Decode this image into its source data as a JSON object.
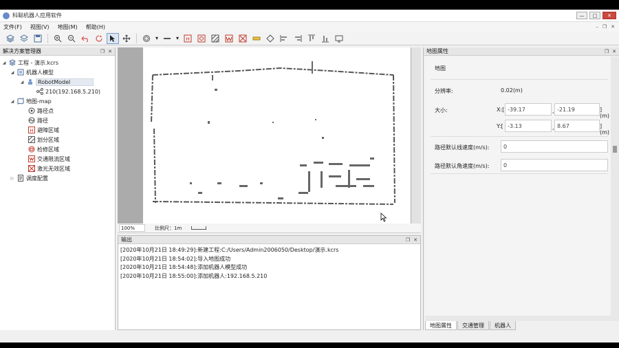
{
  "title": "科聪机器人应用软件",
  "menu": [
    "文件(F)",
    "视图(V)",
    "地图(M)",
    "帮助(H)"
  ],
  "toolbar_icons": [
    "layers-icon",
    "layers-add-icon",
    "save-icon",
    "zoom-in-icon",
    "zoom-out-icon",
    "undo-icon",
    "redo-icon",
    "select-cursor-icon",
    "move-icon",
    "ring-icon",
    "line-icon",
    "area-h-icon",
    "area-r-icon",
    "area-hatch-icon",
    "area-w-icon",
    "area-x-icon",
    "ruler-icon",
    "diamond-icon",
    "align-left-icon",
    "align-center-icon",
    "align-top-icon",
    "align-middle-icon",
    "monitor-icon"
  ],
  "left_panel": {
    "title": "解决方案管理器",
    "tree": {
      "project": "工程 - 演示.kcrs",
      "robot_model": "机器人模型",
      "robot_model_item": "RobotModel",
      "robot_ip": "210(192.168.5.210)",
      "map": "地图-map",
      "map_items": [
        "路径点",
        "路径",
        "避障区域",
        "划分区域",
        "检修区域",
        "交通限流区域",
        "激光无效区域"
      ],
      "dispatch": "调度配置"
    }
  },
  "status": {
    "zoom": "100%",
    "scale_label": "比例尺：1m"
  },
  "output": {
    "title": "输出",
    "lines": [
      "[2020年10月21日 18:49:29]:新建工程:C:/Users/Admin2006050/Desktop/演示.kcrs",
      "[2020年10月21日 18:54:02]:导入地图成功",
      "[2020年10月21日 18:54:48]:添加机器人模型成功",
      "[2020年10月21日 18:55:00]:添加机器人:192.168.5.210"
    ]
  },
  "right_panel": {
    "title": "地图属性",
    "section": "地图",
    "resolution_label": "分辨率:",
    "resolution_value": "0.02(m)",
    "size_label": "大小:",
    "x_label": "X:[",
    "x_min": "-39.17",
    "x_max": "-21.19",
    "y_label": "Y:[",
    "y_min": "-3.13",
    "y_max": "8.67",
    "unit_close": "](m)",
    "comma": ",",
    "line_speed_label": "路径默认线速度(m/s):",
    "line_speed_value": "0",
    "ang_speed_label": "路径默认角速度(m/s):",
    "ang_speed_value": "0",
    "tabs": [
      "地图属性",
      "交通管理",
      "机器人"
    ]
  }
}
